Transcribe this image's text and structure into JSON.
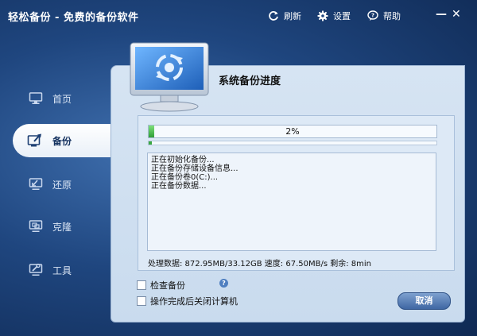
{
  "window": {
    "title": "轻松备份 - 免费的备份软件",
    "toolbar": {
      "refresh_label": "刷新",
      "settings_label": "设置",
      "help_label": "帮助"
    },
    "controls": {
      "minimize": "—",
      "close": "✕"
    }
  },
  "sidebar": {
    "items": [
      {
        "label": "首页",
        "icon": "home-monitor-icon",
        "active": false
      },
      {
        "label": "备份",
        "icon": "backup-icon",
        "active": true
      },
      {
        "label": "还原",
        "icon": "restore-icon",
        "active": false
      },
      {
        "label": "克隆",
        "icon": "clone-icon",
        "active": false
      },
      {
        "label": "工具",
        "icon": "tools-icon",
        "active": false
      }
    ]
  },
  "main": {
    "section_title": "系统备份进度",
    "progress": {
      "percent_text": "2%",
      "percent": 2,
      "secondary_percent": 1
    },
    "log": [
      "正在初始化备份...",
      "正在备份存储设备信息...",
      "正在备份卷0(C:)...",
      "正在备份数据..."
    ],
    "stats": "处理数据: 872.95MB/33.12GB  速度: 67.50MB/s  剩余: 8min",
    "options": {
      "check_backup_label": "检查备份",
      "shutdown_label": "操作完成后关闭计算机",
      "help_glyph": "?"
    },
    "cancel_label": "取消"
  },
  "colors": {
    "accent": "#3f67a3",
    "progress": "#2f9e37",
    "background": "#1f467f"
  }
}
